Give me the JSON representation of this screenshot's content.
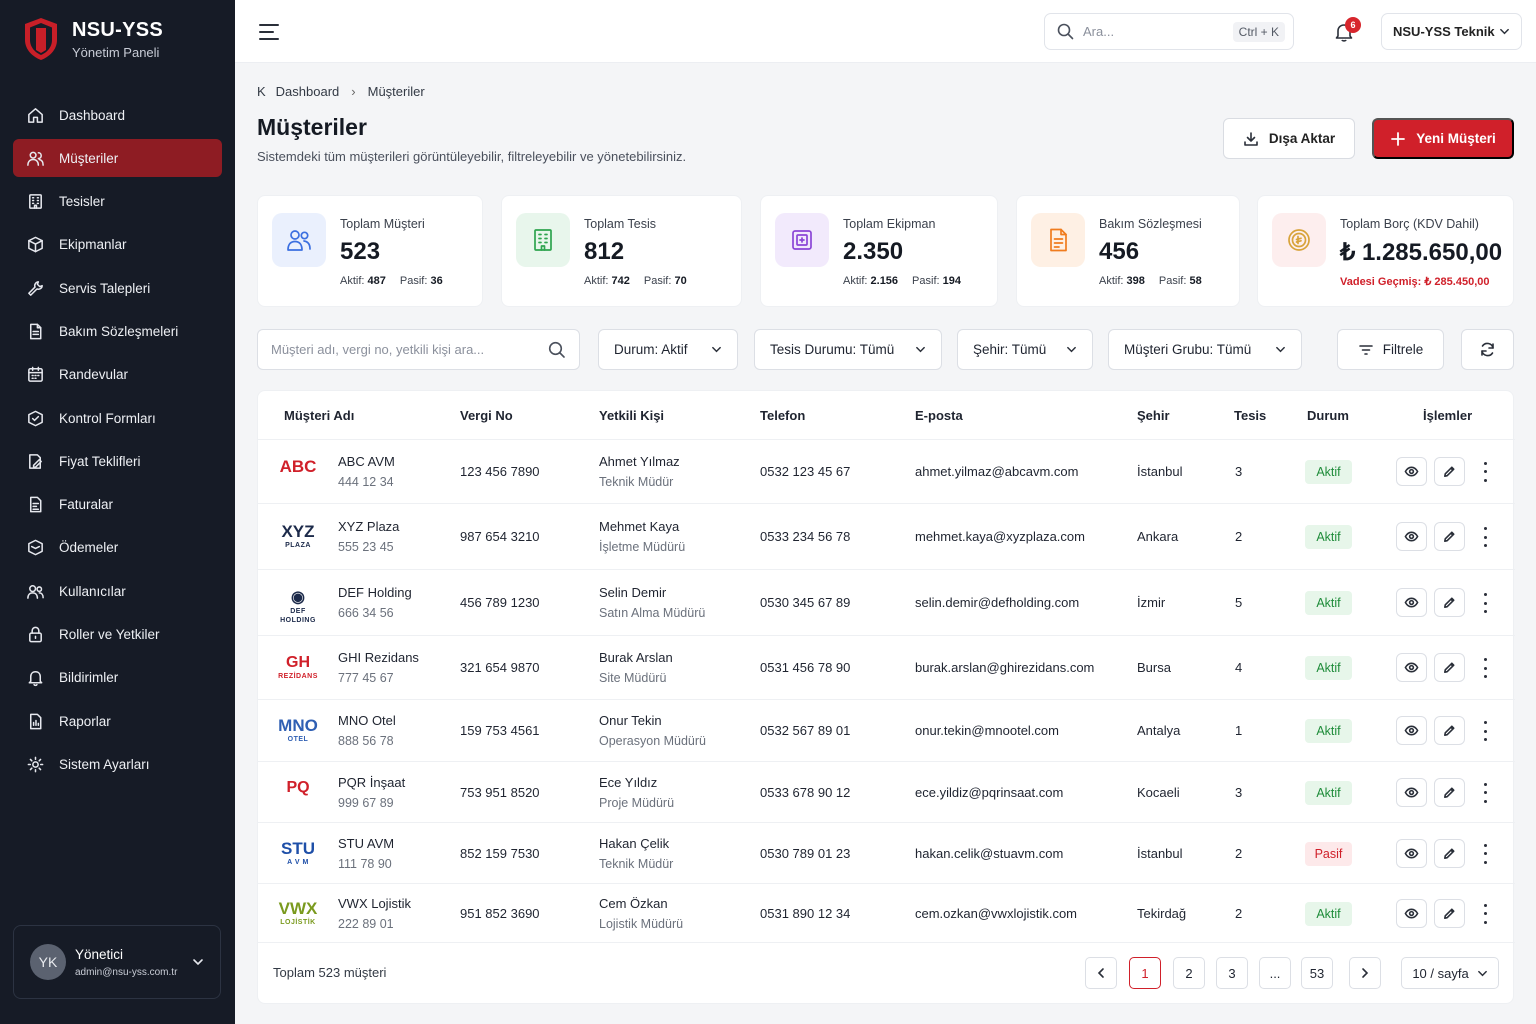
{
  "brand": {
    "title": "NSU-YSS",
    "subtitle": "Yönetim Paneli"
  },
  "sidebar": {
    "items": [
      {
        "label": "Dashboard",
        "icon": "home-icon"
      },
      {
        "label": "Müşteriler",
        "icon": "users-icon",
        "active": true
      },
      {
        "label": "Tesisler",
        "icon": "building-icon"
      },
      {
        "label": "Ekipmanlar",
        "icon": "box-icon"
      },
      {
        "label": "Servis Talepleri",
        "icon": "wrench-icon"
      },
      {
        "label": "Bakım Sözleşmeleri",
        "icon": "contract-icon"
      },
      {
        "label": "Randevular",
        "icon": "calendar-icon"
      },
      {
        "label": "Kontrol Formları",
        "icon": "checklist-icon"
      },
      {
        "label": "Fiyat Teklifleri",
        "icon": "quote-icon"
      },
      {
        "label": "Faturalar",
        "icon": "invoice-icon"
      },
      {
        "label": "Ödemeler",
        "icon": "wallet-icon"
      },
      {
        "label": "Kullanıcılar",
        "icon": "user-group-icon"
      },
      {
        "label": "Roller ve Yetkiler",
        "icon": "lock-icon"
      },
      {
        "label": "Bildirimler",
        "icon": "bell-icon"
      },
      {
        "label": "Raporlar",
        "icon": "report-icon"
      },
      {
        "label": "Sistem Ayarları",
        "icon": "gear-icon"
      }
    ],
    "user": {
      "initials": "YK",
      "name": "Yönetici",
      "email": "admin@nsu-yss.com.tr"
    }
  },
  "topbar": {
    "search_placeholder": "Ara...",
    "shortcut": "Ctrl + K",
    "notification_count": "6",
    "org": "NSU-YSS Teknik"
  },
  "breadcrumb": {
    "root_icon": "K",
    "root": "Dashboard",
    "current": "Müşteriler"
  },
  "page": {
    "title": "Müşteriler",
    "subtitle": "Sistemdeki tüm müşterileri görüntüleyebilir, filtreleyebilir ve yönetebilirsiniz.",
    "export_label": "Dışa Aktar",
    "new_label": "Yeni Müşteri"
  },
  "stats": [
    {
      "label": "Toplam Müşteri",
      "value": "523",
      "a_label": "Aktif:",
      "a_value": "487",
      "b_label": "Pasif:",
      "b_value": "36",
      "color": "#3b6fe0",
      "bg": "#eaf0fd"
    },
    {
      "label": "Toplam Tesis",
      "value": "812",
      "a_label": "Aktif:",
      "a_value": "742",
      "b_label": "Pasif:",
      "b_value": "70",
      "color": "#2ea44f",
      "bg": "#e8f6ec"
    },
    {
      "label": "Toplam Ekipman",
      "value": "2.350",
      "a_label": "Aktif:",
      "a_value": "2.156",
      "b_label": "Pasif:",
      "b_value": "194",
      "color": "#8b46d6",
      "bg": "#f2eafc"
    },
    {
      "label": "Bakım Sözleşmesi",
      "value": "456",
      "a_label": "Aktif:",
      "a_value": "398",
      "b_label": "Pasif:",
      "b_value": "58",
      "color": "#f07c1e",
      "bg": "#fef0e4"
    },
    {
      "label": "Toplam Borç (KDV Dahil)",
      "value": "₺ 1.285.650,00",
      "overdue": "Vadesi Geçmiş: ₺ 285.450,00",
      "color": "#d8a33a",
      "bg": "#fdeeee"
    }
  ],
  "filters": {
    "search_placeholder": "Müşteri adı, vergi no, yetkili kişi ara...",
    "status": "Durum: Aktif",
    "facility_status": "Tesis Durumu: Tümü",
    "city": "Şehir: Tümü",
    "group": "Müşteri Grubu: Tümü",
    "filter_label": "Filtrele"
  },
  "table": {
    "columns": [
      "Müşteri Adı",
      "Vergi No",
      "Yetkili Kişi",
      "Telefon",
      "E-posta",
      "Şehir",
      "Tesis",
      "Durum",
      "İşlemler"
    ],
    "rows": [
      {
        "logo": "ABC",
        "logo_sub": "",
        "logo_color": "#d0202a",
        "name": "ABC AVM",
        "code": "444 12 34",
        "tax": "123 456 7890",
        "contact": "Ahmet Yılmaz",
        "role": "Teknik Müdür",
        "phone": "0532 123 45 67",
        "email": "ahmet.yilmaz@abcavm.com",
        "city": "İstanbul",
        "facilities": "3",
        "status": "Aktif"
      },
      {
        "logo": "XYZ",
        "logo_sub": "PLAZA",
        "logo_color": "#1c2a4a",
        "name": "XYZ Plaza",
        "code": "555 23 45",
        "tax": "987 654 3210",
        "contact": "Mehmet Kaya",
        "role": "İşletme Müdürü",
        "phone": "0533 234 56 78",
        "email": "mehmet.kaya@xyzplaza.com",
        "city": "Ankara",
        "facilities": "2",
        "status": "Aktif"
      },
      {
        "logo": "◉",
        "logo_sub": "DEF HOLDING",
        "logo_color": "#1c2a4a",
        "name": "DEF Holding",
        "code": "666 34 56",
        "tax": "456 789 1230",
        "contact": "Selin Demir",
        "role": "Satın Alma Müdürü",
        "phone": "0530 345 67 89",
        "email": "selin.demir@defholding.com",
        "city": "İzmir",
        "facilities": "5",
        "status": "Aktif"
      },
      {
        "logo": "GH",
        "logo_sub": "REZİDANS",
        "logo_color": "#d0202a",
        "name": "GHI Rezidans",
        "code": "777 45 67",
        "tax": "321 654 9870",
        "contact": "Burak Arslan",
        "role": "Site Müdürü",
        "phone": "0531 456 78 90",
        "email": "burak.arslan@ghirezidans.com",
        "city": "Bursa",
        "facilities": "4",
        "status": "Aktif"
      },
      {
        "logo": "MNO",
        "logo_sub": "OTEL",
        "logo_color": "#2f5fb3",
        "name": "MNO Otel",
        "code": "888 56 78",
        "tax": "159 753 4561",
        "contact": "Onur Tekin",
        "role": "Operasyon Müdürü",
        "phone": "0532 567 89 01",
        "email": "onur.tekin@mnootel.com",
        "city": "Antalya",
        "facilities": "1",
        "status": "Aktif"
      },
      {
        "logo": "PQ",
        "logo_sub": "",
        "logo_color": "#d0202a",
        "name": "PQR İnşaat",
        "code": "999 67 89",
        "tax": "753 951 8520",
        "contact": "Ece Yıldız",
        "role": "Proje Müdürü",
        "phone": "0533 678 90 12",
        "email": "ece.yildiz@pqrinsaat.com",
        "city": "Kocaeli",
        "facilities": "3",
        "status": "Aktif"
      },
      {
        "logo": "STU",
        "logo_sub": "A V M",
        "logo_color": "#1e4fa8",
        "name": "STU AVM",
        "code": "111 78 90",
        "tax": "852 159 7530",
        "contact": "Hakan Çelik",
        "role": "Teknik Müdür",
        "phone": "0530 789 01 23",
        "email": "hakan.celik@stuavm.com",
        "city": "İstanbul",
        "facilities": "2",
        "status": "Pasif"
      },
      {
        "logo": "VWX",
        "logo_sub": "LOJİSTİK",
        "logo_color": "#7a9a1e",
        "name": "VWX Lojistik",
        "code": "222 89 01",
        "tax": "951 852 3690",
        "contact": "Cem Özkan",
        "role": "Lojistik Müdürü",
        "phone": "0531 890 12 34",
        "email": "cem.ozkan@vwxlojistik.com",
        "city": "Tekirdağ",
        "facilities": "2",
        "status": "Aktif"
      }
    ]
  },
  "pagination": {
    "total": "Toplam 523 müşteri",
    "pages": [
      "1",
      "2",
      "3",
      "...",
      "53"
    ],
    "current": "1",
    "per_page": "10 / sayfa"
  }
}
